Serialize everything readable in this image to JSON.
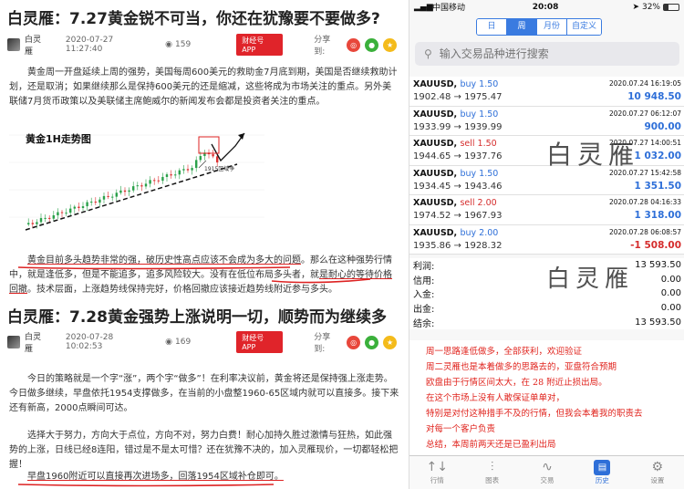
{
  "article1": {
    "title": "白灵雁：7.27黄金锐不可当，你还在犹豫要不要做多?",
    "author": "白灵雁",
    "time": "2020-07-27 11:27:40",
    "views": "159",
    "app_button": "财经号APP",
    "share_label": "分享到:",
    "para1": "黄金周一开盘延续上周的强势，美国每周600美元的救助金7月底到期，美国是否继续救助计划，还是取消；如果继续那么是保持600美元的还是缩减，这些将成为市场关注的重点。另外美联储7月货币政策以及美联储主席鲍威尔的新闻发布会都是投资者关注的重点。",
    "chart_title": "黄金1H走势图",
    "chart_annotation": "1915区域争",
    "para2_underlined": "黄金目前多头趋势非常的强，破历史性高点应该不会成为多大的问题",
    "para2_a": "。那么在这种强势行情中，就是逢低多，但是不能追多，追多风险较大。没有在低位布局多头者，就",
    "para2_underlined2": "是耐心的等待价格回撤",
    "para2_b": "。技术层面，上涨趋势线保持完好，价格回撤应该接近趋势线附近参与多头。"
  },
  "article2": {
    "title": "白灵雁：7.28黄金强势上涨说明一切，顺势而为继续多",
    "author": "白灵雁",
    "time": "2020-07-28 10:02:53",
    "views": "169",
    "app_button": "财经号APP",
    "share_label": "分享到:",
    "para1": "今日的策略就是一个字“涨”，两个字“做多”！在利率决议前，黄金将还是保持强上涨走势。今日做多继续，早盘依托1954支撑做多，在当前的小盘整1960-65区域内就可以直接多。接下来还有新高，2000点瞬间可达。",
    "para2": "选择大于努力，方向大于点位，方向不对，努力白费！耐心加持久胜过激情与狂热，如此强势的上涨，日线已经8连阳，错过是不是太可惜？还在犹豫不决的，加入灵雁现价，一切都轻松把握！",
    "para3": "早盘1960附近可以直接再次进场多，回落1954区域补仓即可。"
  },
  "phone": {
    "status": {
      "carrier": "中国移动",
      "time": "20:08",
      "battery": "32%",
      "battery_level": 0.32
    },
    "period_tabs": [
      "日",
      "周",
      "月份",
      "自定义"
    ],
    "active_period": 1,
    "search_placeholder": "输入交易品种进行搜索",
    "trades": [
      {
        "symbol": "XAUUSD,",
        "side": "buy 1.50",
        "side_type": "buy",
        "datetime": "2020.07.24 16:19:05",
        "prices": "1902.48 → 1975.47",
        "profit": "10 948.50",
        "profit_sign": "pos"
      },
      {
        "symbol": "XAUUSD,",
        "side": "buy 1.50",
        "side_type": "buy",
        "datetime": "2020.07.27 06:12:07",
        "prices": "1933.99 → 1939.99",
        "profit": "900.00",
        "profit_sign": "pos"
      },
      {
        "symbol": "XAUUSD,",
        "side": "sell 1.50",
        "side_type": "sell",
        "datetime": "2020.07.27 14:00:51",
        "prices": "1944.65 → 1937.76",
        "profit": "1 032.00",
        "profit_sign": "pos"
      },
      {
        "symbol": "XAUUSD,",
        "side": "buy 1.50",
        "side_type": "buy",
        "datetime": "2020.07.27 15:42:58",
        "prices": "1934.45 → 1943.46",
        "profit": "1 351.50",
        "profit_sign": "pos"
      },
      {
        "symbol": "XAUUSD,",
        "side": "sell 2.00",
        "side_type": "sell",
        "datetime": "2020.07.28 04:16:33",
        "prices": "1974.52 → 1967.93",
        "profit": "1 318.00",
        "profit_sign": "pos"
      },
      {
        "symbol": "XAUUSD,",
        "side": "buy 2.00",
        "side_type": "buy",
        "datetime": "2020.07.28 06:08:57",
        "prices": "1935.86 → 1928.32",
        "profit": "-1 508.00",
        "profit_sign": "neg"
      }
    ],
    "summary": [
      {
        "label": "利润:",
        "value": "13 593.50"
      },
      {
        "label": "信用:",
        "value": "0.00"
      },
      {
        "label": "入金:",
        "value": "0.00"
      },
      {
        "label": "出金:",
        "value": "0.00"
      },
      {
        "label": "结余:",
        "value": "13 593.50"
      }
    ],
    "notes": [
      "周一思路逢低做多，全部获利，欢迎验证",
      "周二灵雁也是本着做多的思路去的，亚盘符合预期",
      "欧盘由于行情区间太大，在 28 附近止损出局。",
      "在这个市场上没有人敢保证单单对，",
      "特别是对付这种措手不及的行情，但我会本着我的职责去",
      "对每一个客户负责",
      "总结，本周前两天还是已盈利出局"
    ],
    "watermark": "白灵雁",
    "tabbar": [
      {
        "label": "行情",
        "icon": "↑↓"
      },
      {
        "label": "图表",
        "icon": "⫶"
      },
      {
        "label": "交易",
        "icon": "∿"
      },
      {
        "label": "历史",
        "icon": "▤"
      },
      {
        "label": "设置",
        "icon": "⚙"
      }
    ],
    "active_tab": 3
  }
}
